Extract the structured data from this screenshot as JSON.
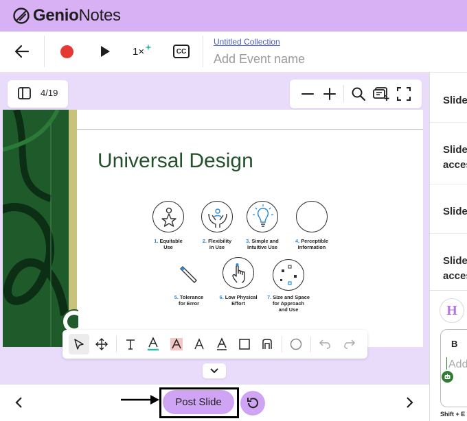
{
  "app": {
    "name_part1": "Genio",
    "name_part2": "Notes"
  },
  "toolbar": {
    "speed": "1×",
    "captions": "CC",
    "collection_link": "Untitled Collection",
    "event_placeholder": "Add Event name"
  },
  "viewer": {
    "page_indicator": "4/19"
  },
  "slide": {
    "title": "Universal Design",
    "principles": [
      {
        "num": "1.",
        "line1": "Equitable",
        "line2": "Use",
        "line3": ""
      },
      {
        "num": "2.",
        "line1": "Flexibility",
        "line2": "in Use",
        "line3": ""
      },
      {
        "num": "3.",
        "line1": "Simple and",
        "line2": "Intuitive Use",
        "line3": ""
      },
      {
        "num": "4.",
        "line1": "Perceptible",
        "line2": "Information",
        "line3": ""
      },
      {
        "num": "5.",
        "line1": "Tolerance",
        "line2": "for Error",
        "line3": ""
      },
      {
        "num": "6.",
        "line1": "Low Physical",
        "line2": "Effort",
        "line3": ""
      },
      {
        "num": "7.",
        "line1": "Size and Space",
        "line2": "for Approach",
        "line3": "and Use"
      }
    ]
  },
  "bottom": {
    "post_slide": "Post Slide"
  },
  "right_panel": {
    "items": [
      {
        "line1": "Slide",
        "line2": ""
      },
      {
        "line1": "Slide",
        "line2": "acces"
      },
      {
        "line1": "Slide",
        "line2": ""
      },
      {
        "line1": "Slide",
        "line2": "acces"
      }
    ],
    "avatar_letter": "H",
    "bold_button": "B",
    "note_placeholder": "Add",
    "shortcut_hint": "Shift + E"
  },
  "colors": {
    "header_bg": "#d8b0f4",
    "workspace_bg": "#e9dcfb",
    "accent_purple": "#cfa4f4",
    "record_red": "#e53935",
    "slide_green": "#24502c",
    "link_blue": "#4b5cc4",
    "sparkle_teal": "#2ab8a8"
  }
}
